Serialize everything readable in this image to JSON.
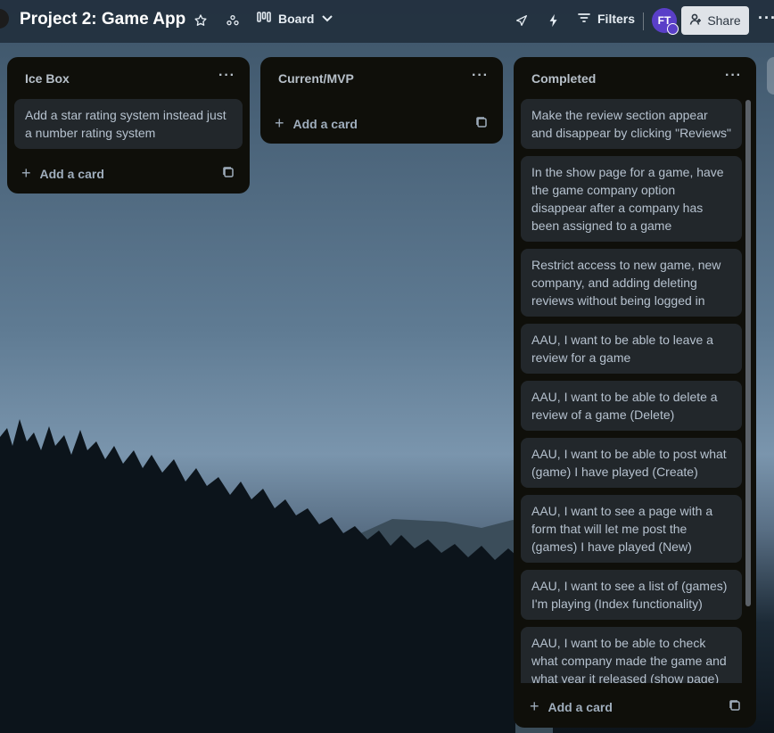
{
  "header": {
    "board_title": "Project 2: Game App",
    "view_label": "Board",
    "filters_label": "Filters",
    "avatar_initials": "FT",
    "share_label": "Share",
    "icons": [
      "star-icon",
      "workspace-visibility-icon",
      "board-view-icon",
      "chevron-down-icon",
      "rocket-icon",
      "lightning-icon",
      "filter-icon",
      "share-person-icon",
      "more-icon"
    ]
  },
  "lists": [
    {
      "title": "Ice Box",
      "cards": [
        "Add a star rating system instead just a number rating system"
      ],
      "add_label": "Add a card"
    },
    {
      "title": "Current/MVP",
      "cards": [],
      "add_label": "Add a card"
    },
    {
      "title": "Completed",
      "cards": [
        "Make the review section appear and disappear by clicking \"Reviews\"",
        "In the show page for a game, have the game company option disappear after a company has been assigned to a game",
        "Restrict access to new game, new company, and adding deleting reviews without being logged in",
        "AAU, I want to be able to leave a review for a game",
        "AAU, I want to be able to delete a review of a game (Delete)",
        "AAU, I want to be able to post what (game) I have played (Create)",
        "AAU, I want to see a page with a form that will let me post the (games) I have played (New)",
        "AAU, I want to see a list of (games) I'm playing (Index functionality)",
        "AAU, I want to be able to check what company made the game and what year it released (show page)"
      ],
      "add_label": "Add a card"
    }
  ],
  "colors": {
    "list_bg": "#0f0f0a",
    "card_bg": "#22272b",
    "card_text": "#b6c2cf",
    "avatar": "#5a3fc8",
    "share_bg": "#dfe3e8"
  }
}
